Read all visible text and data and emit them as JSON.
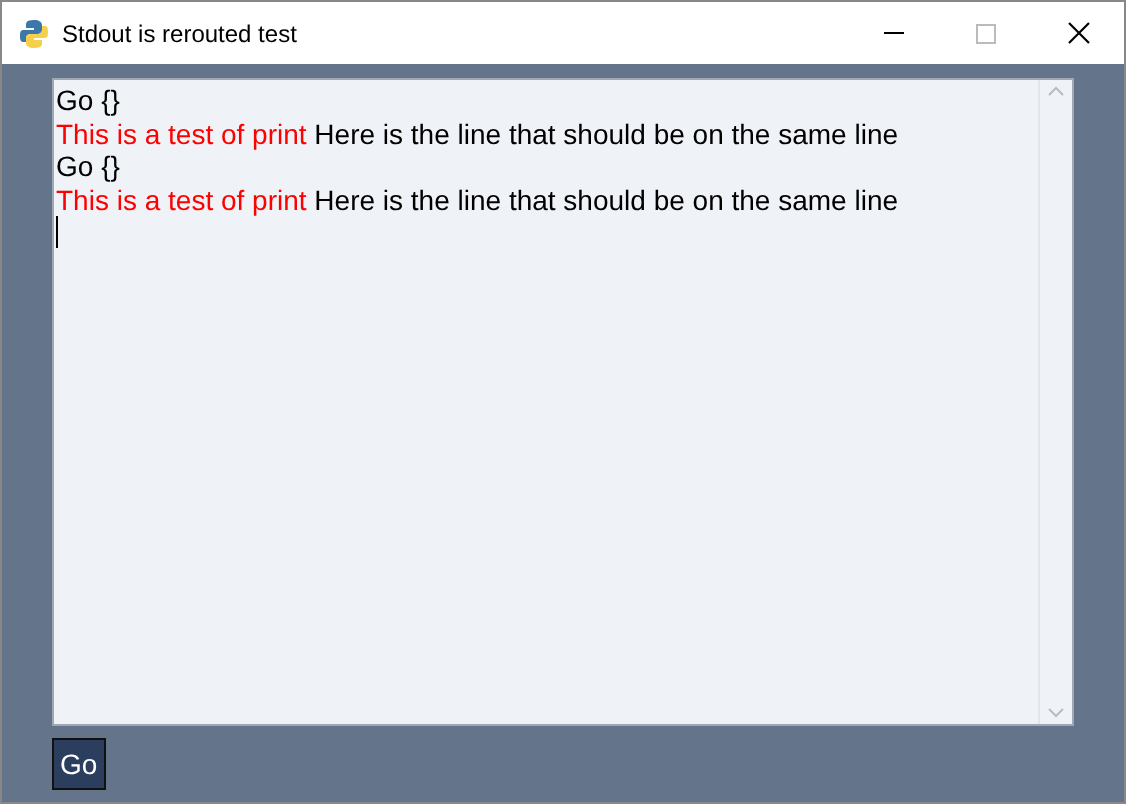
{
  "window": {
    "title": "Stdout is rerouted test"
  },
  "output": {
    "lines": [
      {
        "segments": [
          {
            "text": "Go {}",
            "color": "#000000"
          }
        ]
      },
      {
        "segments": [
          {
            "text": "This is a test of print",
            "color": "#ff0000"
          },
          {
            "text": "Here is the line that should be on the same line",
            "color": "#000000"
          }
        ]
      },
      {
        "segments": [
          {
            "text": "Go {}",
            "color": "#000000"
          }
        ]
      },
      {
        "segments": [
          {
            "text": "This is a test of print",
            "color": "#ff0000"
          },
          {
            "text": "Here is the line that should be on the same line",
            "color": "#000000"
          }
        ]
      }
    ]
  },
  "buttons": [
    {
      "label": "Go"
    }
  ]
}
